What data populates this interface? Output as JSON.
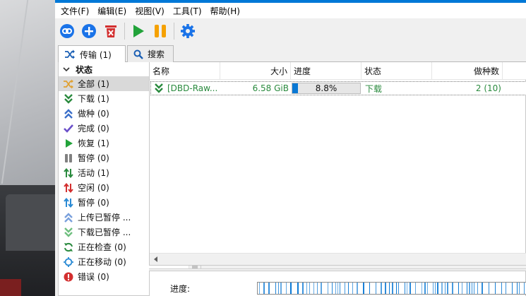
{
  "menubar": {
    "items": [
      "文件(F)",
      "编辑(E)",
      "视图(V)",
      "工具(T)",
      "帮助(H)"
    ]
  },
  "toolbar": {
    "buttons": [
      {
        "name": "add-link",
        "icon": "link-icon",
        "color": "#1a73e8"
      },
      {
        "name": "add-torrent",
        "icon": "plus-circle-icon",
        "color": "#1a73e8"
      },
      {
        "name": "delete",
        "icon": "trash-icon",
        "color": "#d32f2f"
      },
      {
        "name": "resume",
        "icon": "play-icon",
        "color": "#22a33a"
      },
      {
        "name": "pause",
        "icon": "pause-icon",
        "color": "#f5a100"
      },
      {
        "name": "options",
        "icon": "gear-icon",
        "color": "#1a73e8"
      }
    ]
  },
  "tabs": [
    {
      "label": "传输 (1)",
      "icon": "shuffle-icon",
      "active": true
    },
    {
      "label": "搜索",
      "icon": "search-icon",
      "active": false
    }
  ],
  "sidebar": {
    "section_title": "状态",
    "items": [
      {
        "label": "全部 (1)",
        "icon": "shuffle-icon",
        "color": "#e0a030",
        "selected": true
      },
      {
        "label": "下载 (1)",
        "icon": "double-chevron-down-icon",
        "color": "#2a8a3e"
      },
      {
        "label": "做种 (0)",
        "icon": "double-chevron-up-icon",
        "color": "#3b6fc9"
      },
      {
        "label": "完成 (0)",
        "icon": "check-icon",
        "color": "#6a4fc9"
      },
      {
        "label": "恢复 (1)",
        "icon": "play-icon",
        "color": "#22a33a"
      },
      {
        "label": "暂停 (0)",
        "icon": "pause-icon",
        "color": "#808080"
      },
      {
        "label": "活动 (1)",
        "icon": "updown-arrows-icon",
        "color": "#2a8a3e"
      },
      {
        "label": "空闲 (0)",
        "icon": "updown-arrows-icon",
        "color": "#d32f2f"
      },
      {
        "label": "暂停 (0)",
        "icon": "updown-arrows-icon",
        "color": "#2a8ad4"
      },
      {
        "label": "上传已暂停 ...",
        "icon": "double-chevron-up-icon",
        "color": "#7aa0dc"
      },
      {
        "label": "下载已暂停 ...",
        "icon": "double-chevron-down-icon",
        "color": "#6fbf7f"
      },
      {
        "label": "正在检查 (0)",
        "icon": "refresh-icon",
        "color": "#2a8a3e"
      },
      {
        "label": "正在移动 (0)",
        "icon": "crosshair-icon",
        "color": "#2a8ad4"
      },
      {
        "label": "错误 (0)",
        "icon": "error-icon",
        "color": "#d32f2f"
      }
    ]
  },
  "list": {
    "columns": [
      "名称",
      "大小",
      "进度",
      "状态",
      "做种数"
    ],
    "rows": [
      {
        "name": "[DBD-Raw...",
        "size": "6.58 GiB",
        "progress_text": "8.8%",
        "progress": 0.088,
        "status": "下载",
        "seeds": "2 (10)"
      }
    ]
  },
  "detail": {
    "progress_label": "进度:"
  },
  "colors": {
    "accent": "#0078d7",
    "progress": "#0a78d4",
    "downloading_text": "#2a8a3e"
  }
}
